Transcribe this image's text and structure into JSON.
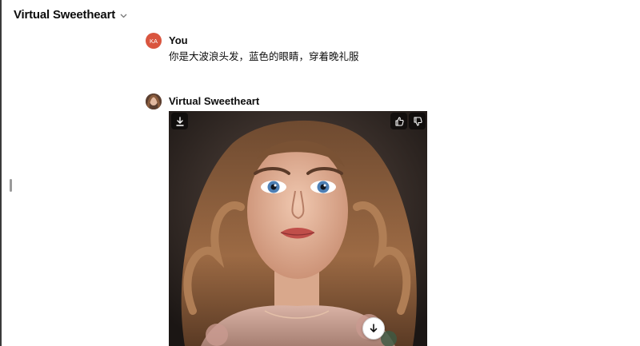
{
  "header": {
    "title": "Virtual Sweetheart",
    "chevron_icon": "chevron-down-icon"
  },
  "conversation": {
    "user_message": {
      "author": "You",
      "avatar_initials": "KA",
      "avatar_color": "#d9553f",
      "text": "你是大波浪头发，蓝色的眼睛，穿着晚礼服"
    },
    "assistant_message": {
      "author": "Virtual Sweetheart",
      "avatar_icon": "portrait-avatar-icon",
      "image": {
        "subject": "portrait-image",
        "actions": [
          "download-icon",
          "thumbs-up-icon",
          "thumbs-down-icon"
        ]
      }
    },
    "scroll_button_icon": "arrow-down-icon"
  }
}
